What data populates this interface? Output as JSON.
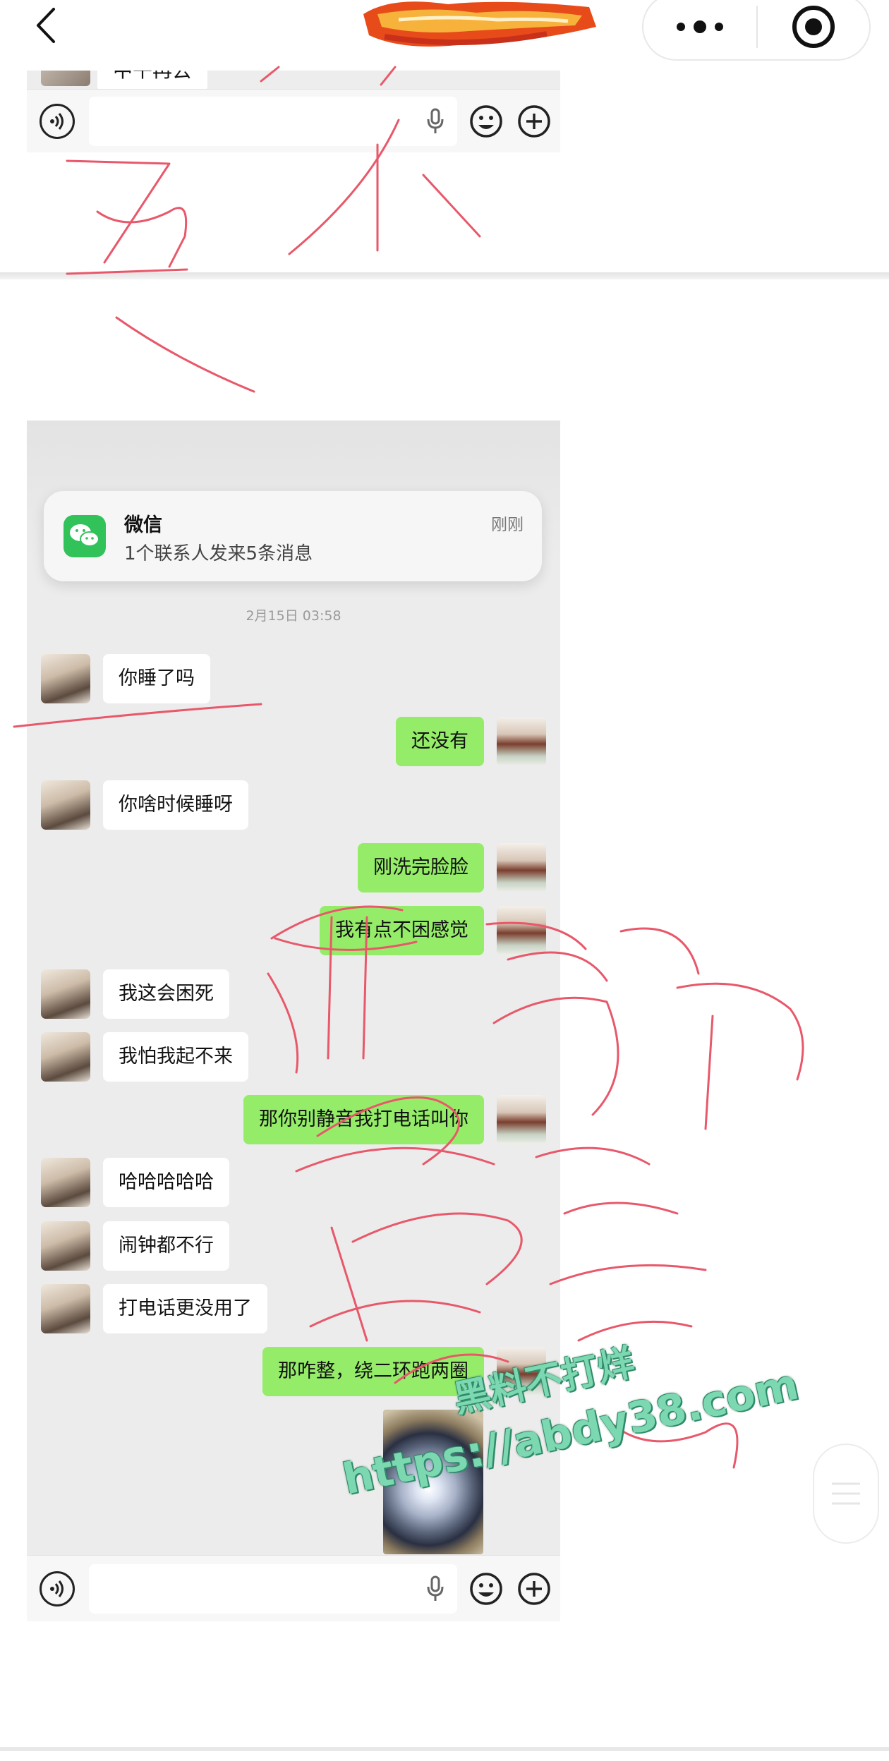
{
  "nav": {
    "back_icon": "chevron-left-icon",
    "more_icon": "more-dots-icon",
    "close_icon": "target-circle-icon"
  },
  "input_bar": {
    "voice_icon": "voice-icon",
    "mic_icon": "mic-icon",
    "emoji_icon": "emoji-icon",
    "plus_icon": "plus-icon"
  },
  "top_screenshot": {
    "peek_text": "中午再去"
  },
  "notification": {
    "app_name": "微信",
    "message": "1个联系人发来5条消息",
    "time": "刚刚"
  },
  "chat": {
    "timestamp": "2月15日 03:58",
    "messages": [
      {
        "side": "left",
        "text": "你睡了吗"
      },
      {
        "side": "right",
        "text": "还没有"
      },
      {
        "side": "left",
        "text": "你啥时候睡呀"
      },
      {
        "side": "right",
        "text": "刚洗完脸脸"
      },
      {
        "side": "right",
        "text": "我有点不困感觉"
      },
      {
        "side": "left",
        "text": "我这会困死"
      },
      {
        "side": "left",
        "text": "我怕我起不来"
      },
      {
        "side": "right",
        "text": "那你别静音我打电话叫你"
      },
      {
        "side": "left",
        "text": "哈哈哈哈哈"
      },
      {
        "side": "left",
        "text": "闹钟都不行"
      },
      {
        "side": "left",
        "text": "打电话更没用了"
      },
      {
        "side": "right",
        "text": "那咋整，绕二环跑两圈"
      }
    ]
  },
  "watermark": {
    "line1": "黑料不打烊",
    "line2": "https://abdy38.com"
  },
  "colors": {
    "sent_bubble": "#95ec69",
    "received_bubble": "#ffffff",
    "chat_bg": "#ececec",
    "wechat_green": "#32c25a",
    "scribble_red": "#e8586a"
  }
}
